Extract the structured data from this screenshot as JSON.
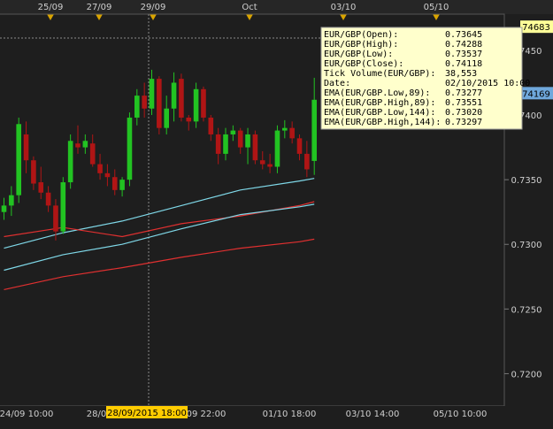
{
  "chart_data": {
    "type": "candlestick",
    "symbol": "EUR/GBP",
    "y_ticks": [
      "0.7450",
      "0.7400",
      "0.7350",
      "0.7300",
      "0.7250",
      "0.7200"
    ],
    "ylim": [
      0.7175,
      0.7478
    ],
    "grid": false,
    "top_date_labels": [
      "25/09",
      "27/09",
      "29/09",
      "Oct",
      "03/10",
      "05/10"
    ],
    "bottom_time_labels": [
      "24/09 10:00",
      "28/0",
      "09 22:00",
      "01/10 18:00",
      "03/10 14:00",
      "05/10 10:00"
    ],
    "crosshair_time_label": "28/09/2015 18:00",
    "price_badges": [
      {
        "value": "74683",
        "price": 0.74683,
        "color": "#ffff99"
      },
      {
        "value": "74169",
        "price": 0.74169,
        "color": "#6fa8dc"
      }
    ],
    "candles": [
      {
        "o": 0.7325,
        "h": 0.7336,
        "l": 0.7319,
        "c": 0.733
      },
      {
        "o": 0.733,
        "h": 0.7345,
        "l": 0.7322,
        "c": 0.7338
      },
      {
        "o": 0.7338,
        "h": 0.7398,
        "l": 0.7332,
        "c": 0.7393
      },
      {
        "o": 0.7385,
        "h": 0.7395,
        "l": 0.7355,
        "c": 0.7365
      },
      {
        "o": 0.7365,
        "h": 0.7368,
        "l": 0.7342,
        "c": 0.7347
      },
      {
        "o": 0.7348,
        "h": 0.736,
        "l": 0.7335,
        "c": 0.734
      },
      {
        "o": 0.734,
        "h": 0.7345,
        "l": 0.7325,
        "c": 0.733
      },
      {
        "o": 0.733,
        "h": 0.7335,
        "l": 0.7303,
        "c": 0.731
      },
      {
        "o": 0.731,
        "h": 0.7352,
        "l": 0.7308,
        "c": 0.7348
      },
      {
        "o": 0.7348,
        "h": 0.7385,
        "l": 0.7343,
        "c": 0.738
      },
      {
        "o": 0.7378,
        "h": 0.7392,
        "l": 0.737,
        "c": 0.7375
      },
      {
        "o": 0.7375,
        "h": 0.7385,
        "l": 0.737,
        "c": 0.738
      },
      {
        "o": 0.7378,
        "h": 0.7385,
        "l": 0.736,
        "c": 0.7362
      },
      {
        "o": 0.7362,
        "h": 0.737,
        "l": 0.735,
        "c": 0.7355
      },
      {
        "o": 0.7355,
        "h": 0.7362,
        "l": 0.7345,
        "c": 0.7352
      },
      {
        "o": 0.7352,
        "h": 0.7358,
        "l": 0.7338,
        "c": 0.7342
      },
      {
        "o": 0.7342,
        "h": 0.7352,
        "l": 0.7337,
        "c": 0.735
      },
      {
        "o": 0.735,
        "h": 0.7402,
        "l": 0.7345,
        "c": 0.7398
      },
      {
        "o": 0.7398,
        "h": 0.742,
        "l": 0.7392,
        "c": 0.7415
      },
      {
        "o": 0.7415,
        "h": 0.7425,
        "l": 0.7398,
        "c": 0.7405
      },
      {
        "o": 0.7405,
        "h": 0.7435,
        "l": 0.74,
        "c": 0.7428
      },
      {
        "o": 0.7428,
        "h": 0.743,
        "l": 0.7385,
        "c": 0.739
      },
      {
        "o": 0.739,
        "h": 0.7415,
        "l": 0.7385,
        "c": 0.7405
      },
      {
        "o": 0.7405,
        "h": 0.7433,
        "l": 0.7395,
        "c": 0.7425
      },
      {
        "o": 0.7428,
        "h": 0.7432,
        "l": 0.7395,
        "c": 0.7398
      },
      {
        "o": 0.7398,
        "h": 0.74,
        "l": 0.7388,
        "c": 0.7395
      },
      {
        "o": 0.7395,
        "h": 0.7425,
        "l": 0.739,
        "c": 0.742
      },
      {
        "o": 0.742,
        "h": 0.7422,
        "l": 0.7395,
        "c": 0.7398
      },
      {
        "o": 0.7398,
        "h": 0.74,
        "l": 0.738,
        "c": 0.7385
      },
      {
        "o": 0.7385,
        "h": 0.739,
        "l": 0.7362,
        "c": 0.737
      },
      {
        "o": 0.737,
        "h": 0.739,
        "l": 0.7365,
        "c": 0.7385
      },
      {
        "o": 0.7385,
        "h": 0.7392,
        "l": 0.738,
        "c": 0.7388
      },
      {
        "o": 0.7388,
        "h": 0.739,
        "l": 0.737,
        "c": 0.7375
      },
      {
        "o": 0.7375,
        "h": 0.739,
        "l": 0.7362,
        "c": 0.7385
      },
      {
        "o": 0.7385,
        "h": 0.7388,
        "l": 0.7362,
        "c": 0.7365
      },
      {
        "o": 0.7365,
        "h": 0.7372,
        "l": 0.7358,
        "c": 0.7362
      },
      {
        "o": 0.7362,
        "h": 0.737,
        "l": 0.7355,
        "c": 0.736
      },
      {
        "o": 0.736,
        "h": 0.7392,
        "l": 0.7355,
        "c": 0.7388
      },
      {
        "o": 0.7388,
        "h": 0.7396,
        "l": 0.7382,
        "c": 0.739
      },
      {
        "o": 0.739,
        "h": 0.7395,
        "l": 0.7378,
        "c": 0.7382
      },
      {
        "o": 0.7382,
        "h": 0.7385,
        "l": 0.7365,
        "c": 0.737
      },
      {
        "o": 0.737,
        "h": 0.738,
        "l": 0.7352,
        "c": 0.7358
      },
      {
        "o": 0.73645,
        "h": 0.74288,
        "l": 0.73537,
        "c": 0.74118
      }
    ],
    "series": [
      {
        "key": "ema_low_89",
        "color": "#7fd8e8",
        "values": [
          [
            0,
            0.7297
          ],
          [
            8,
            0.7309
          ],
          [
            16,
            0.7318
          ],
          [
            24,
            0.733
          ],
          [
            32,
            0.7342
          ],
          [
            40,
            0.7349
          ],
          [
            42,
            0.7351
          ]
        ]
      },
      {
        "key": "ema_high_89",
        "color": "#e03030",
        "values": [
          [
            0,
            0.7306
          ],
          [
            8,
            0.7313
          ],
          [
            16,
            0.7306
          ],
          [
            24,
            0.7316
          ],
          [
            32,
            0.7322
          ],
          [
            40,
            0.733
          ],
          [
            42,
            0.7333
          ]
        ]
      },
      {
        "key": "ema_low_144",
        "color": "#7fd8e8",
        "values": [
          [
            0,
            0.728
          ],
          [
            8,
            0.7292
          ],
          [
            16,
            0.73
          ],
          [
            24,
            0.7312
          ],
          [
            32,
            0.7323
          ],
          [
            40,
            0.7329
          ],
          [
            42,
            0.7331
          ]
        ]
      },
      {
        "key": "ema_high_144",
        "color": "#e03030",
        "values": [
          [
            0,
            0.7265
          ],
          [
            8,
            0.7275
          ],
          [
            16,
            0.7282
          ],
          [
            24,
            0.729
          ],
          [
            32,
            0.7297
          ],
          [
            40,
            0.7302
          ],
          [
            42,
            0.7304
          ]
        ]
      }
    ],
    "tooltip": {
      "rows": [
        {
          "label": "EUR/GBP(Open):",
          "value": "0.73645"
        },
        {
          "label": "EUR/GBP(High):",
          "value": "0.74288"
        },
        {
          "label": "EUR/GBP(Low):",
          "value": "0.73537"
        },
        {
          "label": "EUR/GBP(Close):",
          "value": "0.74118"
        },
        {
          "label": "Tick Volume(EUR/GBP):",
          "value": "38,553"
        },
        {
          "label": "Date:",
          "value": "02/10/2015 10:00"
        },
        {
          "label": "EMA(EUR/GBP.Low,89):",
          "value": "0.73277"
        },
        {
          "label": "EMA(EUR/GBP.High,89):",
          "value": "0.73551"
        },
        {
          "label": "EMA(EUR/GBP.Low,144):",
          "value": "0.73020"
        },
        {
          "label": "EMA(EUR/GBP.High,144):",
          "value": "0.73297"
        }
      ]
    },
    "colors": {
      "background": "#1e1e1e",
      "up": "#22c322",
      "down": "#b01515",
      "axis_text": "#cfcfcf",
      "tooltip_bg": "#ffffcc",
      "marker": "#d9a400",
      "crosshair_label_bg": "#ffcc00"
    }
  }
}
